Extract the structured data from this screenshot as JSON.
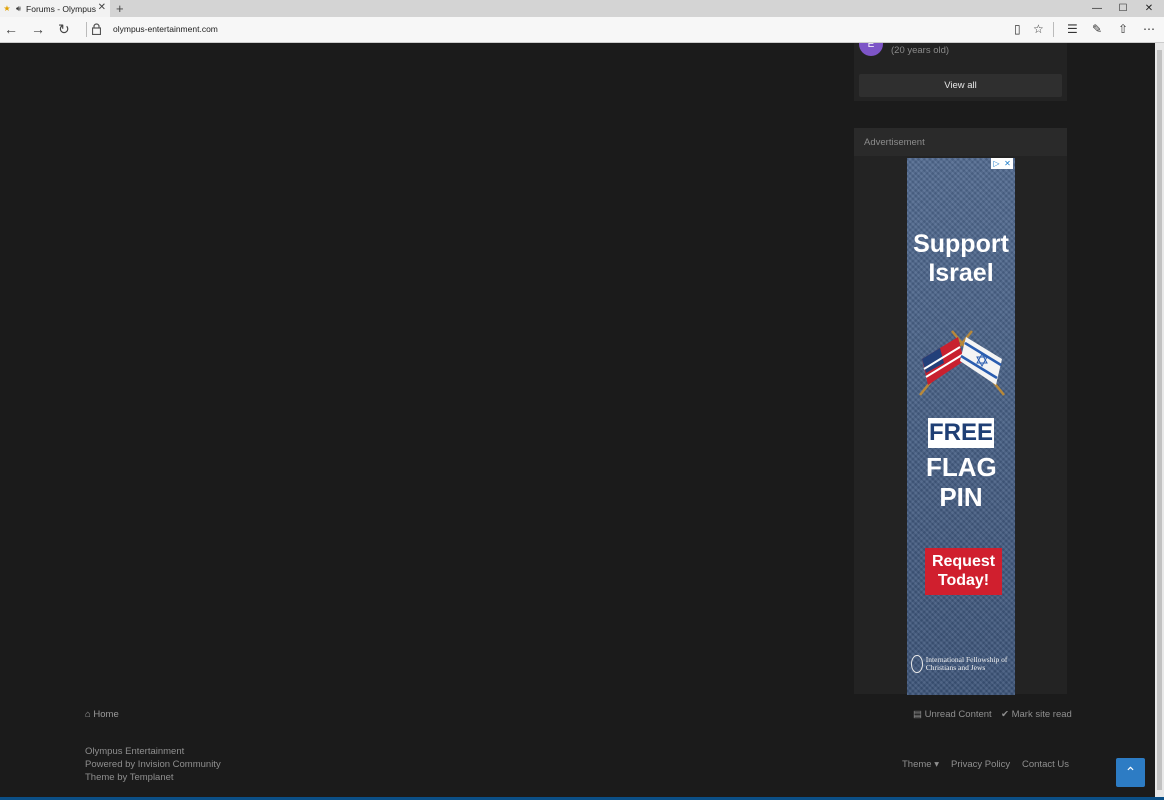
{
  "browser": {
    "tab_title": "Forums - Olympus",
    "url": "olympus-entertainment.com",
    "new_tab_icon": "plus-icon",
    "window_controls": [
      "minimize",
      "maximize",
      "close"
    ]
  },
  "sidebar": {
    "member_age": "(20 years old)",
    "avatar_letter": "E",
    "view_all_label": "View all",
    "advertisement_label": "Advertisement"
  },
  "ad": {
    "headline": "Support Israel",
    "free": "FREE",
    "flag_pin": "FLAG PIN",
    "cta": "Request Today!",
    "sponsor": "International Fellowship of Christians and Jews"
  },
  "footer": {
    "home": "Home",
    "unread_content": "Unread Content",
    "mark_site_read": "Mark site read",
    "site_name": "Olympus Entertainment",
    "powered_by": "Powered by Invision Community",
    "theme_by": "Theme by Templanet",
    "theme_menu": "Theme",
    "privacy_policy": "Privacy Policy",
    "contact_us": "Contact Us"
  },
  "colors": {
    "page_bg": "#1b1b1b",
    "widget_bg": "#232323",
    "accent_blue": "#2d7cc4",
    "avatar_purple": "#7d55c7"
  }
}
